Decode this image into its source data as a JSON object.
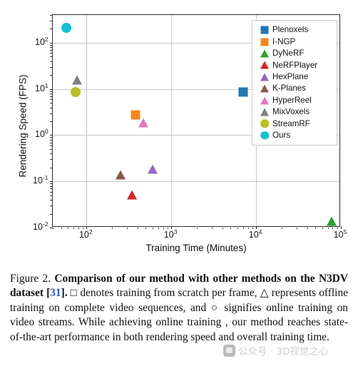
{
  "figure": {
    "caption_lead": "Figure 2.",
    "caption_bold_1": "Comparison of our method with other methods on the N3DV dataset [",
    "caption_ref": "31",
    "caption_bold_2": "].",
    "caption_rest_1": " □ denotes training from scratch per frame, △ represents offline training on complete video sequences, and ○ signifies online training on video streams. While achieving online training , our method reaches state-of-the-art performance in both rendering speed and overall training time."
  },
  "watermark": {
    "text": "公众号 · 3D视觉之心",
    "logo_name": "watermark-logo"
  },
  "chart_data": {
    "type": "scatter",
    "title": "",
    "xlabel": "Training Time (Minutes)",
    "ylabel": "Rendering Speed (FPS)",
    "xscale": "log",
    "yscale": "log",
    "xlim": [
      40,
      100000
    ],
    "ylim": [
      0.01,
      400
    ],
    "grid": true,
    "legend_position": "upper right",
    "xticks": [
      {
        "value": 100,
        "label": "10",
        "exp": "2"
      },
      {
        "value": 1000,
        "label": "10",
        "exp": "3"
      },
      {
        "value": 10000,
        "label": "10",
        "exp": "4"
      },
      {
        "value": 100000,
        "label": "10",
        "exp": "5"
      }
    ],
    "yticks": [
      {
        "value": 100,
        "label": "10",
        "exp": "2"
      },
      {
        "value": 10,
        "label": "10",
        "exp": "1"
      },
      {
        "value": 1,
        "label": "10",
        "exp": "0"
      },
      {
        "value": 0.1,
        "label": "10",
        "exp": "-1"
      },
      {
        "value": 0.01,
        "label": "10",
        "exp": "-2"
      }
    ],
    "series": [
      {
        "name": "Plenoxels",
        "marker": "square",
        "color": "#1f77b4",
        "x": 7000,
        "y": 8.5
      },
      {
        "name": "I-NGP",
        "marker": "square",
        "color": "#f5871f",
        "x": 380,
        "y": 2.8
      },
      {
        "name": "DyNeRF",
        "marker": "triangle",
        "color": "#2ca02c",
        "x": 77000,
        "y": 0.015
      },
      {
        "name": "NeRFPlayer",
        "marker": "triangle",
        "color": "#d62728",
        "x": 340,
        "y": 0.056
      },
      {
        "name": "HexPlane",
        "marker": "triangle",
        "color": "#9467bd",
        "x": 600,
        "y": 0.2
      },
      {
        "name": "K-Planes",
        "marker": "triangle",
        "color": "#8c564b",
        "x": 250,
        "y": 0.15
      },
      {
        "name": "HyperReel",
        "marker": "triangle",
        "color": "#e377c2",
        "x": 470,
        "y": 2.0
      },
      {
        "name": "MixVoxels",
        "marker": "triangle",
        "color": "#7f7f7f",
        "x": 78,
        "y": 17
      },
      {
        "name": "StreamRF",
        "marker": "circle",
        "color": "#bcbd22",
        "x": 75,
        "y": 8.5
      },
      {
        "name": "Ours",
        "marker": "circle",
        "color": "#17becf",
        "x": 58,
        "y": 210
      }
    ]
  }
}
